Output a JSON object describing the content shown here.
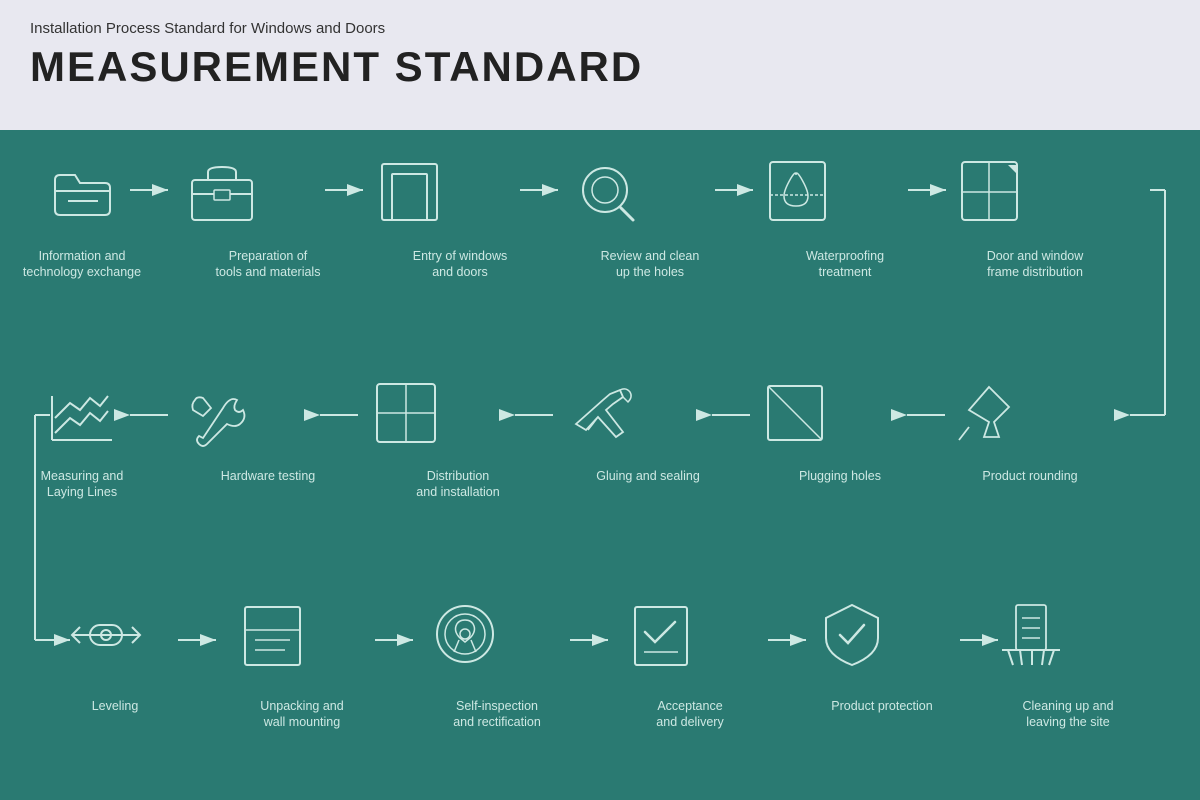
{
  "header": {
    "subtitle": "Installation Process Standard for Windows and Doors",
    "title": "MEASUREMENT STANDARD"
  },
  "steps": [
    {
      "id": "info",
      "label": "Information and technology exchange",
      "row": 1,
      "col": 1
    },
    {
      "id": "prep",
      "label": "Preparation of tools and materials",
      "row": 1,
      "col": 2
    },
    {
      "id": "entry",
      "label": "Entry of windows and doors",
      "row": 1,
      "col": 3
    },
    {
      "id": "review",
      "label": "Review and clean up the holes",
      "row": 1,
      "col": 4
    },
    {
      "id": "waterproof",
      "label": "Waterproofing treatment",
      "row": 1,
      "col": 5
    },
    {
      "id": "frame",
      "label": "Door and window frame distribution",
      "row": 1,
      "col": 6
    },
    {
      "id": "product-round",
      "label": "Product rounding",
      "row": 2,
      "col": 6
    },
    {
      "id": "plug",
      "label": "Plugging holes",
      "row": 2,
      "col": 5
    },
    {
      "id": "glue",
      "label": "Gluing and sealing",
      "row": 2,
      "col": 4
    },
    {
      "id": "distrib",
      "label": "Distribution and installation",
      "row": 2,
      "col": 3
    },
    {
      "id": "hardware",
      "label": "Hardware testing",
      "row": 2,
      "col": 2
    },
    {
      "id": "measure",
      "label": "Measuring and Laying Lines",
      "row": 2,
      "col": 1
    },
    {
      "id": "level",
      "label": "Leveling",
      "row": 3,
      "col": 1
    },
    {
      "id": "unpack",
      "label": "Unpacking and wall mounting",
      "row": 3,
      "col": 2
    },
    {
      "id": "self-inspect",
      "label": "Self-inspection and rectification",
      "row": 3,
      "col": 3
    },
    {
      "id": "accept",
      "label": "Acceptance and delivery",
      "row": 3,
      "col": 4
    },
    {
      "id": "protect",
      "label": "Product protection",
      "row": 3,
      "col": 5
    },
    {
      "id": "clean",
      "label": "Cleaning up and leaving the site",
      "row": 3,
      "col": 6
    }
  ],
  "colors": {
    "background": "#2a7a72",
    "header_bg": "#e8e8f0",
    "icon_stroke": "#cde8e3",
    "text": "#cde8e3"
  }
}
